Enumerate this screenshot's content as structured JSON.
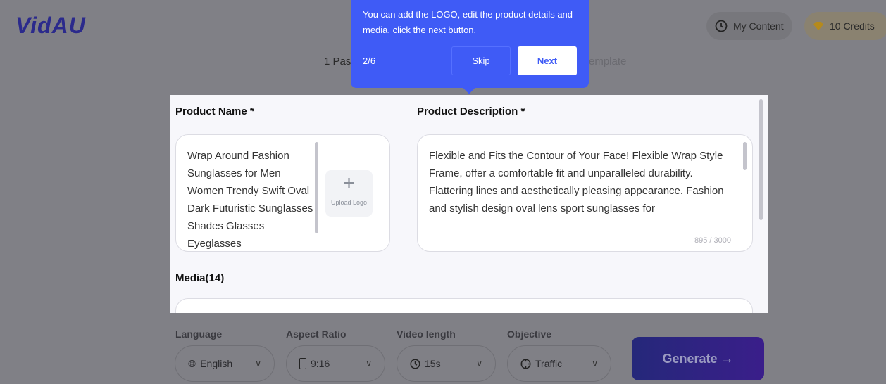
{
  "header": {
    "logo": "VidAU",
    "my_content": "My Content",
    "credits": "10 Credits"
  },
  "steps": {
    "visible_left": "1 Pas",
    "visible_right": "emplate"
  },
  "form": {
    "product_name_label": "Product Name *",
    "product_name_value": "Wrap Around Fashion Sunglasses for Men Women Trendy Swift Oval Dark Futuristic Sunglasses Shades Glasses Eyeglasses",
    "upload_logo": "Upload Logo",
    "product_description_label": "Product Description *",
    "product_description_value": "Flexible and Fits the Contour of Your Face! Flexible Wrap Style Frame, offer a comfortable fit and unparalleled durability.\nFlattering lines and aesthetically pleasing appearance. Fashion and stylish design oval lens sport sunglasses for",
    "char_count": "895 / 3000",
    "media_label": "Media(14)"
  },
  "tour": {
    "message": "You can add the LOGO, edit the product details and media, click the next button.",
    "step": "2/6",
    "skip": "Skip",
    "next": "Next",
    "color": "#3f5bf6"
  },
  "options": {
    "language": {
      "label": "Language",
      "value": "English"
    },
    "aspect_ratio": {
      "label": "Aspect Ratio",
      "value": "9:16"
    },
    "video_length": {
      "label": "Video length",
      "value": "15s"
    },
    "objective": {
      "label": "Objective",
      "value": "Traffic"
    }
  },
  "generate": "Generate →"
}
